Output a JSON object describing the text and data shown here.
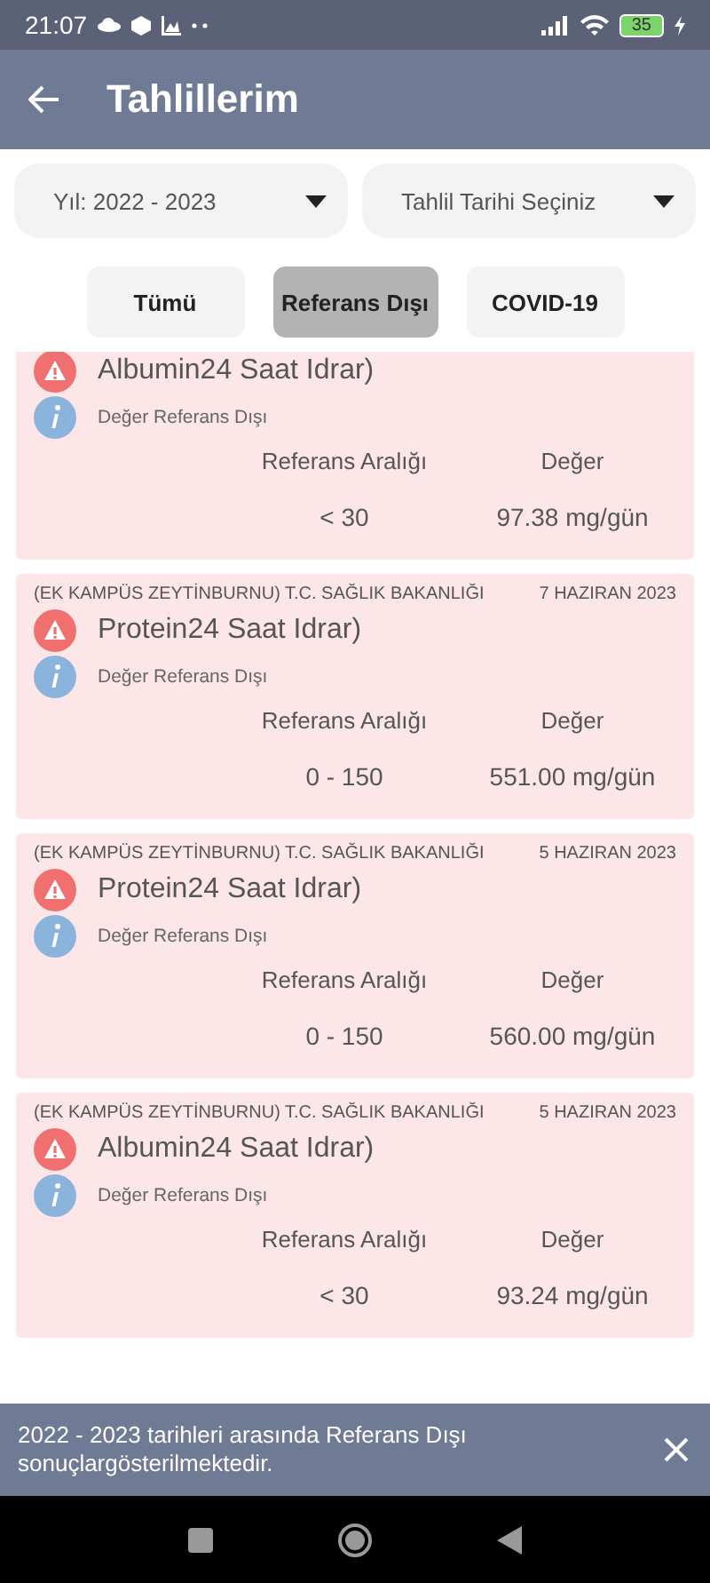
{
  "status_bar": {
    "time": "21:07",
    "battery": "35"
  },
  "app_bar": {
    "title": "Tahlillerim"
  },
  "filters": [
    {
      "label": "Yıl: 2022 - 2023"
    },
    {
      "label": "Tahlil Tarihi Seçiniz"
    }
  ],
  "tabs": [
    {
      "label": "Tümü",
      "selected": false
    },
    {
      "label": "Referans Dışı",
      "selected": true
    },
    {
      "label": "COVID-19",
      "selected": false
    }
  ],
  "results": [
    {
      "title": "Albumin24 Saat Idrar)",
      "note": "Değer Referans Dışı",
      "range_label": "Referans Aralığı",
      "value_label": "Değer",
      "range": "< 30",
      "value": "97.38 mg/gün"
    },
    {
      "institution": "(EK KAMPÜS ZEYTİNBURNU) T.C. SAĞLIK BAKANLIĞI",
      "date": "7 HAZIRAN 2023",
      "title": "Protein24 Saat Idrar)",
      "note": "Değer Referans Dışı",
      "range_label": "Referans Aralığı",
      "value_label": "Değer",
      "range": "0 - 150",
      "value": "551.00 mg/gün"
    },
    {
      "institution": "(EK KAMPÜS ZEYTİNBURNU) T.C. SAĞLIK BAKANLIĞI",
      "date": "5 HAZIRAN 2023",
      "title": "Protein24 Saat Idrar)",
      "note": "Değer Referans Dışı",
      "range_label": "Referans Aralığı",
      "value_label": "Değer",
      "range": "0 - 150",
      "value": "560.00 mg/gün"
    },
    {
      "institution": "(EK KAMPÜS ZEYTİNBURNU) T.C. SAĞLIK BAKANLIĞI",
      "date": "5 HAZIRAN 2023",
      "title": "Albumin24 Saat Idrar)",
      "note": "Değer Referans Dışı",
      "range_label": "Referans Aralığı",
      "value_label": "Değer",
      "range": "< 30",
      "value": "93.24 mg/gün"
    }
  ],
  "snackbar": {
    "message": "2022 - 2023 tarihleri arasında Referans Dışı sonuçlargösterilmektedir."
  }
}
